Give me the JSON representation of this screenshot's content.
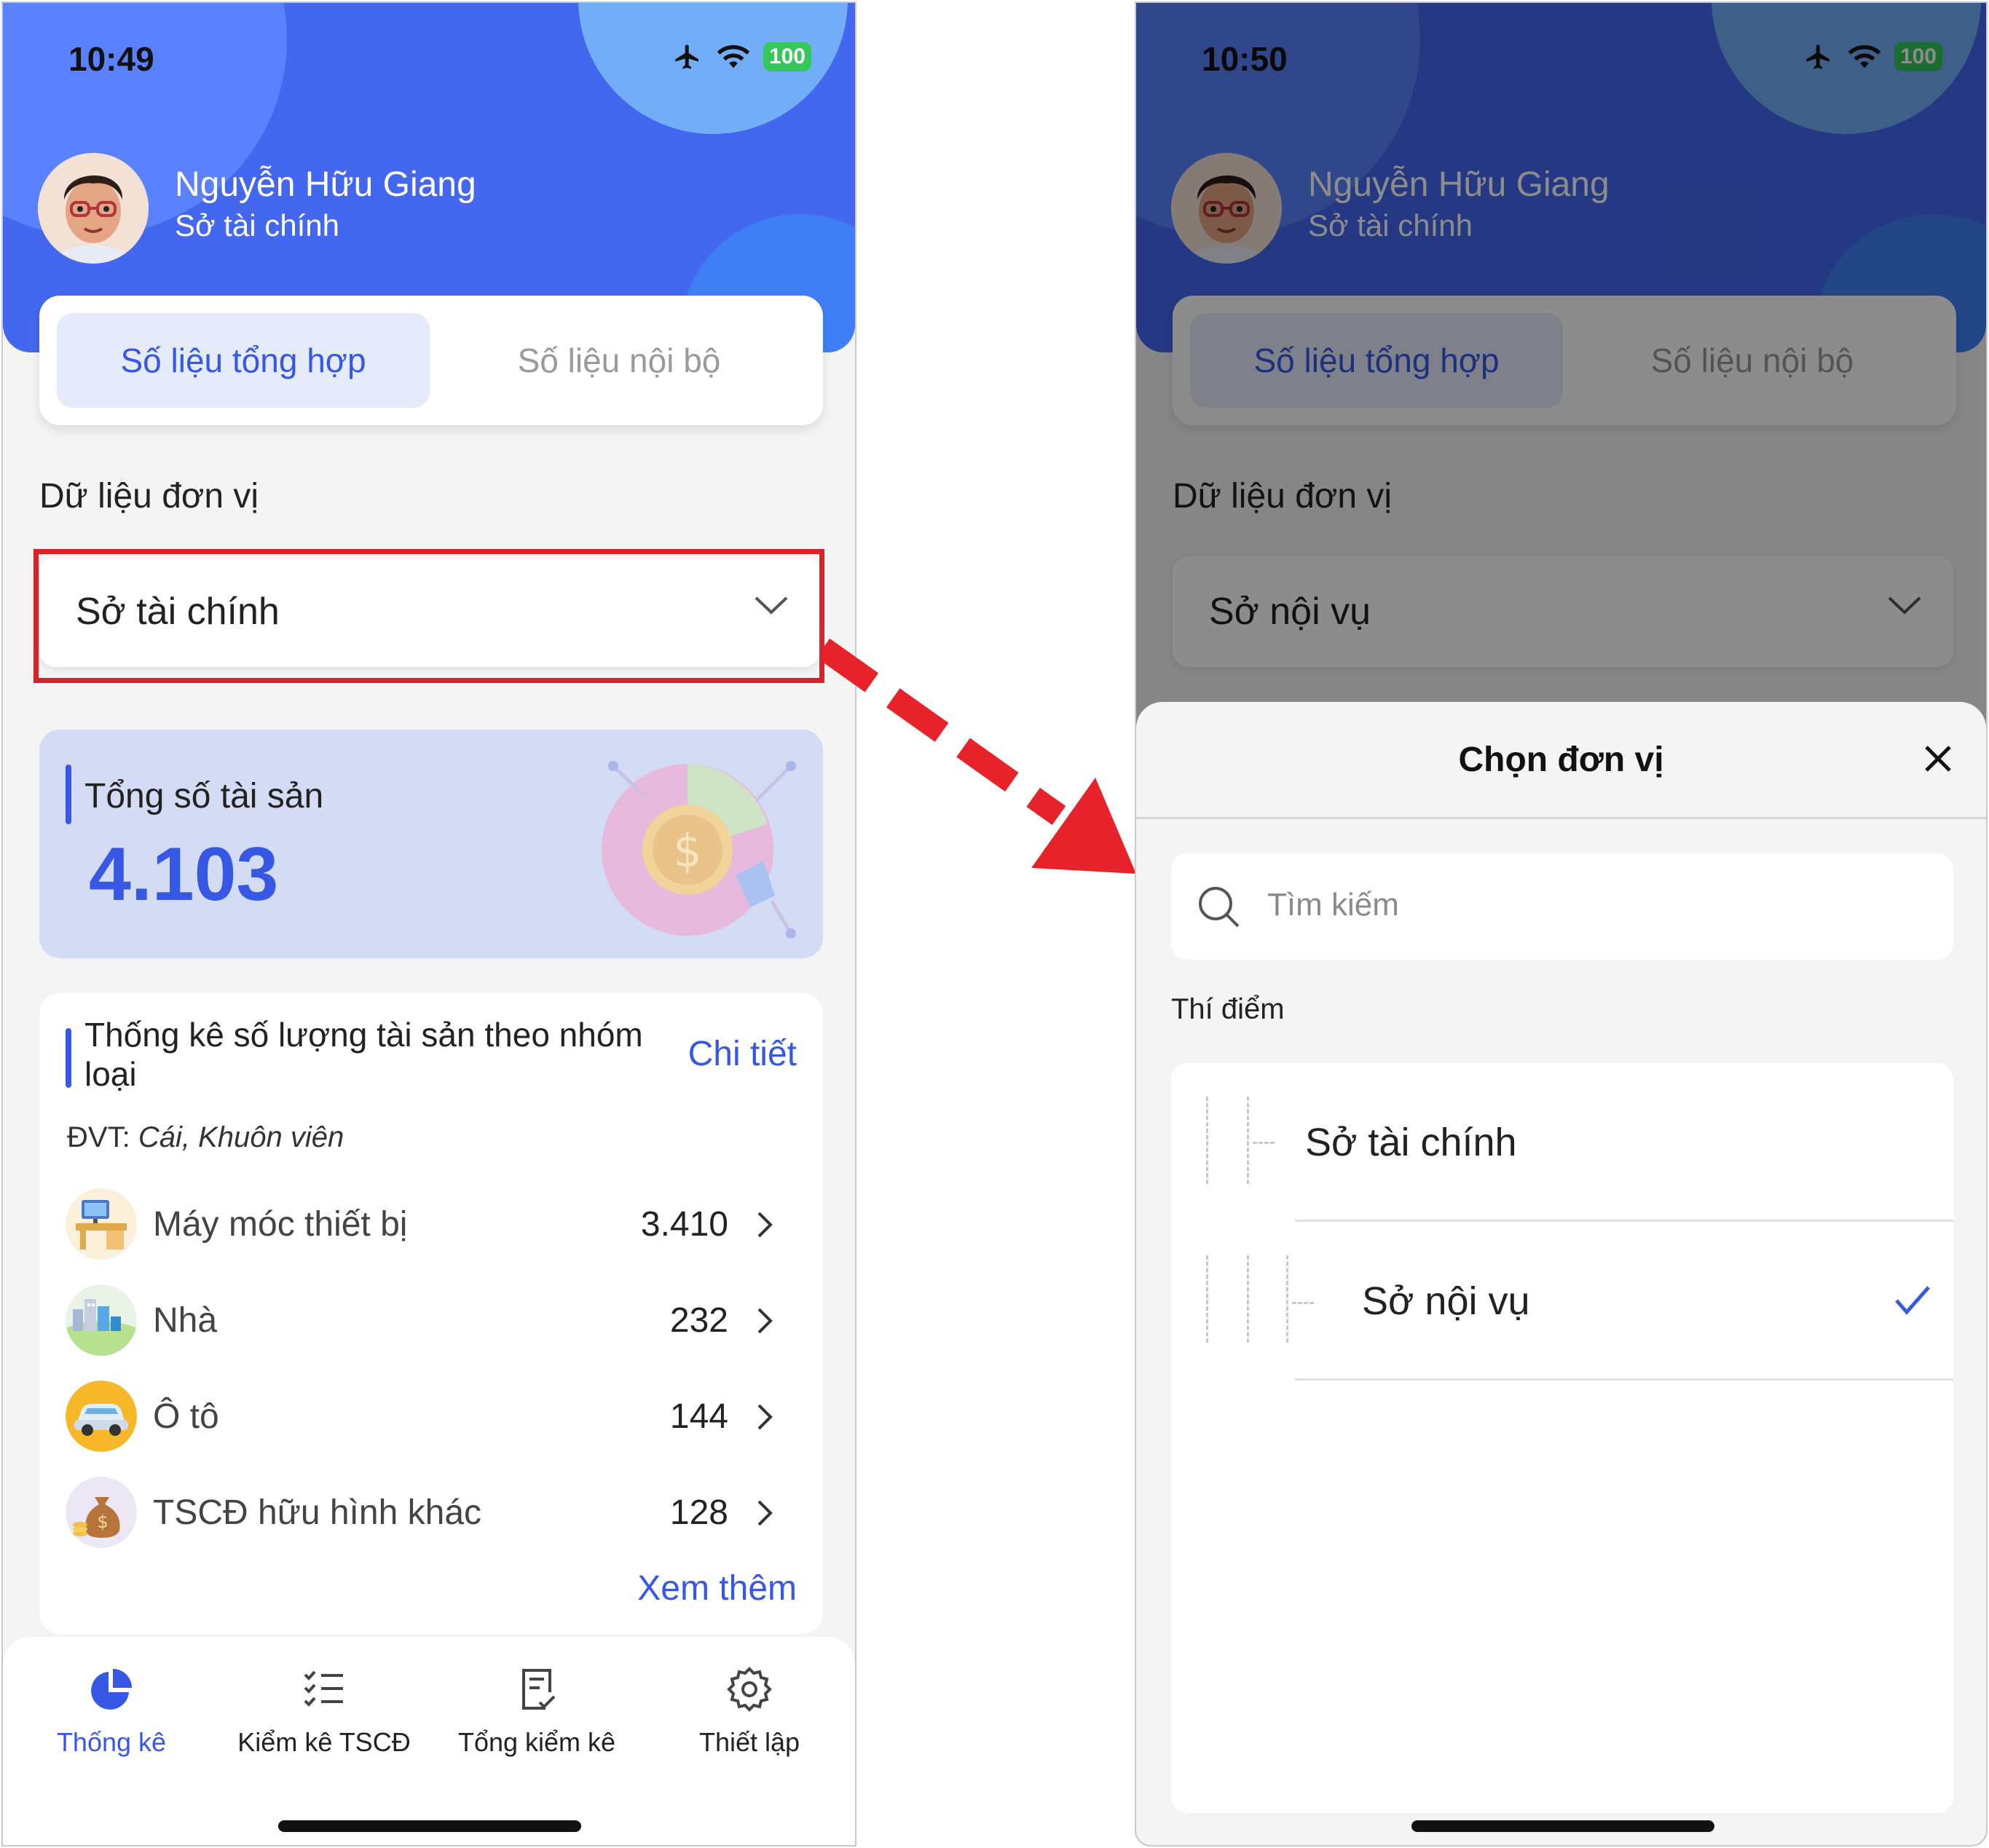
{
  "left": {
    "status": {
      "time": "10:49",
      "battery": "100"
    },
    "user": {
      "name": "Nguyễn Hữu Giang",
      "unit": "Sở tài chính"
    },
    "tabs": {
      "active": "Số liệu tổng hợp",
      "inactive": "Số liệu nội bộ"
    },
    "section_label": "Dữ liệu đơn vị",
    "selected_unit": "Sở tài chính",
    "total": {
      "label": "Tổng số tài sản",
      "value": "4.103"
    },
    "stats": {
      "title": "Thống kê số lượng tài sản theo nhóm loại",
      "detail_link": "Chi tiết",
      "unit_prefix": "ĐVT:",
      "unit_value": "Cái, Khuôn viên",
      "categories": [
        {
          "name": "Máy móc thiết bị",
          "count": "3.410",
          "icon": "office-desk-icon"
        },
        {
          "name": "Nhà",
          "count": "232",
          "icon": "buildings-icon"
        },
        {
          "name": "Ô tô",
          "count": "144",
          "icon": "car-icon"
        },
        {
          "name": "TSCĐ hữu hình khác",
          "count": "128",
          "icon": "money-bag-icon"
        }
      ],
      "more_link": "Xem thêm"
    },
    "nav": [
      {
        "label": "Thống kê",
        "icon": "pie-chart-icon",
        "active": true
      },
      {
        "label": "Kiểm kê TSCĐ",
        "icon": "checklist-icon",
        "active": false
      },
      {
        "label": "Tổng kiểm kê",
        "icon": "document-check-icon",
        "active": false
      },
      {
        "label": "Thiết lập",
        "icon": "gear-icon",
        "active": false
      }
    ]
  },
  "right": {
    "status": {
      "time": "10:50",
      "battery": "100"
    },
    "user": {
      "name": "Nguyễn Hữu Giang",
      "unit": "Sở tài chính"
    },
    "tabs": {
      "active": "Số liệu tổng hợp",
      "inactive": "Số liệu nội bộ"
    },
    "section_label": "Dữ liệu đơn vị",
    "selected_unit": "Sở nội vụ",
    "sheet": {
      "title": "Chọn đơn vị",
      "search_placeholder": "Tìm kiếm",
      "group_label": "Thí điểm",
      "options": [
        {
          "label": "Sở tài chính",
          "selected": false
        },
        {
          "label": "Sở nội vụ",
          "selected": true
        }
      ]
    }
  },
  "colors": {
    "accent": "#3658e4",
    "header": "#4367ef",
    "annotation": "#e8222a"
  }
}
